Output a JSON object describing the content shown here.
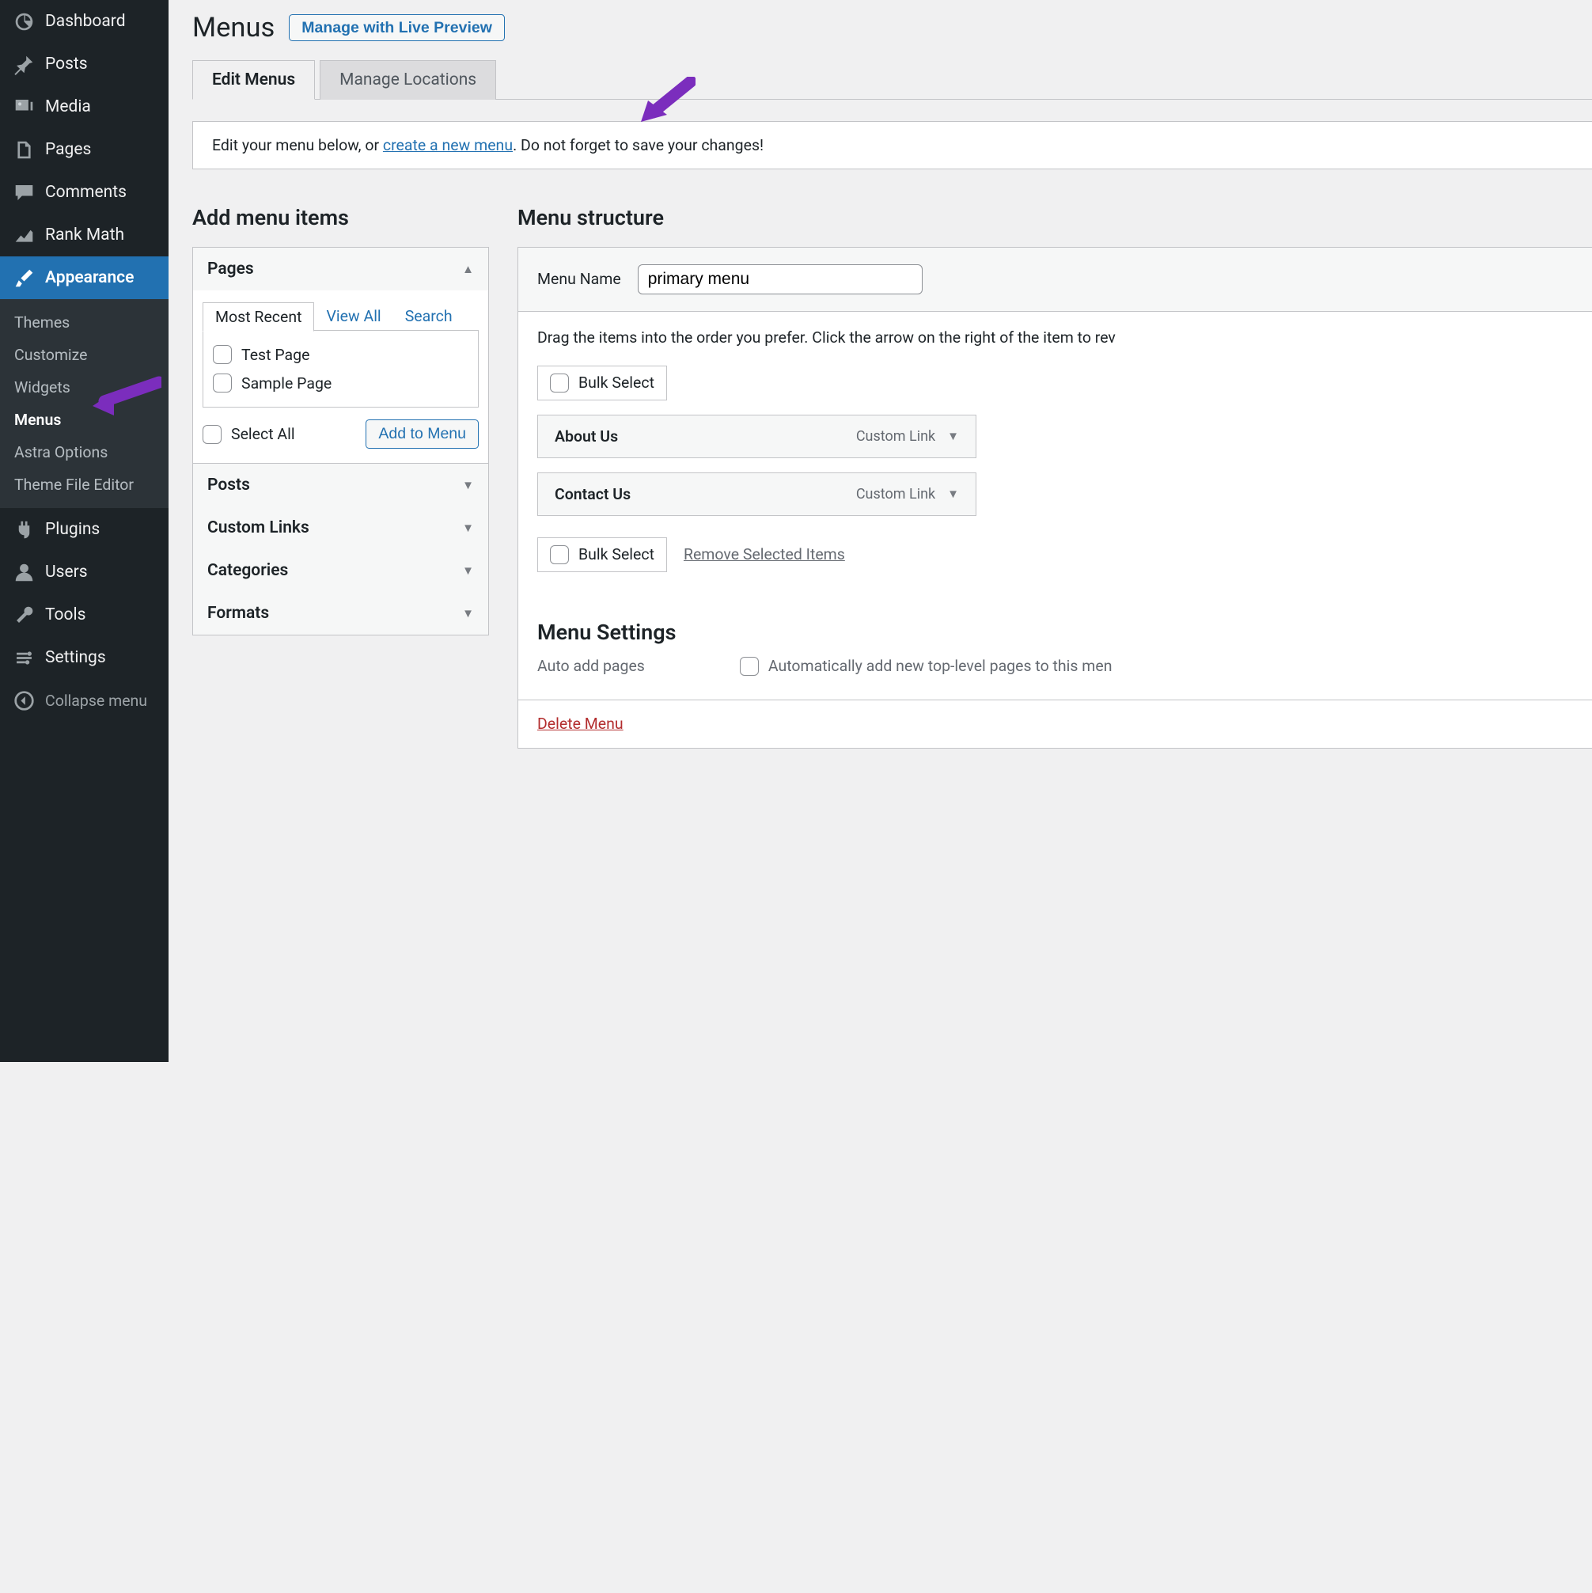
{
  "sidebar": {
    "dashboard": "Dashboard",
    "posts": "Posts",
    "media": "Media",
    "pages": "Pages",
    "comments": "Comments",
    "rankmath": "Rank Math",
    "appearance": "Appearance",
    "appearance_sub": {
      "themes": "Themes",
      "customize": "Customize",
      "widgets": "Widgets",
      "menus": "Menus",
      "astra": "Astra Options",
      "editor": "Theme File Editor"
    },
    "plugins": "Plugins",
    "users": "Users",
    "tools": "Tools",
    "settings": "Settings",
    "collapse": "Collapse menu"
  },
  "page": {
    "title": "Menus",
    "live_preview_btn": "Manage with Live Preview",
    "tabs": {
      "edit": "Edit Menus",
      "manage": "Manage Locations"
    },
    "info_prefix": "Edit your menu below, or ",
    "info_link": "create a new menu",
    "info_suffix": ". Do not forget to save your changes!"
  },
  "add_items": {
    "heading": "Add menu items",
    "pages_title": "Pages",
    "subtabs": {
      "recent": "Most Recent",
      "viewall": "View All",
      "search": "Search"
    },
    "page_list": [
      "Test Page",
      "Sample Page"
    ],
    "select_all": "Select All",
    "add_to_menu": "Add to Menu",
    "posts_title": "Posts",
    "customlinks_title": "Custom Links",
    "categories_title": "Categories",
    "formats_title": "Formats"
  },
  "structure": {
    "heading": "Menu structure",
    "menu_name_label": "Menu Name",
    "menu_name_value": "primary menu",
    "drag_desc": "Drag the items into the order you prefer. Click the arrow on the right of the item to rev",
    "bulk_select": "Bulk Select",
    "items": [
      {
        "label": "About Us",
        "type": "Custom Link"
      },
      {
        "label": "Contact Us",
        "type": "Custom Link"
      }
    ],
    "remove_selected": "Remove Selected Items"
  },
  "settings": {
    "heading": "Menu Settings",
    "auto_add_label": "Auto add pages",
    "auto_add_check": "Automatically add new top-level pages to this men"
  },
  "delete_menu": "Delete Menu"
}
